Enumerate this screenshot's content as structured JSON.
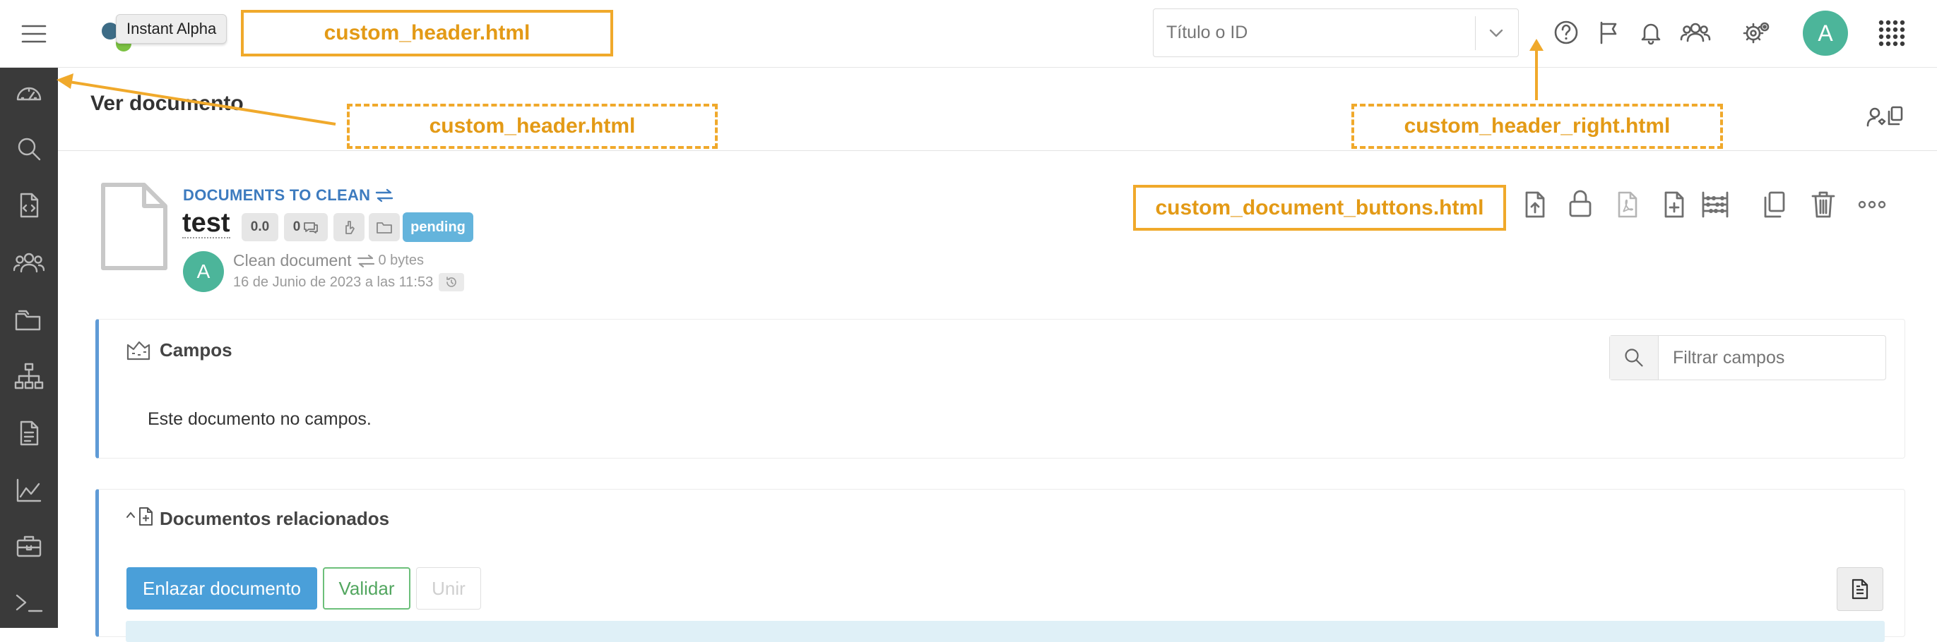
{
  "header": {
    "menu_icon": "hamburger-icon",
    "tooltip": "Instant Alpha",
    "search": {
      "placeholder": "Título o ID"
    },
    "avatar_letter": "A",
    "icons": [
      "help-icon",
      "flag-icon",
      "bell-icon",
      "users-icon",
      "gear-icon",
      "apps-grid-icon"
    ]
  },
  "annotations": {
    "header_top": "custom_header.html",
    "header_sidebar": "custom_header.html",
    "header_right": "custom_header_right.html",
    "document_buttons": "custom_document_buttons.html"
  },
  "sidebar": {
    "items": [
      "dashboard-icon",
      "search-icon",
      "code-file-icon",
      "users-icon",
      "folders-icon",
      "hierarchy-icon",
      "document-icon",
      "chart-icon",
      "toolbox-icon",
      "terminal-icon"
    ]
  },
  "page": {
    "title": "Ver documento"
  },
  "document": {
    "cabinet": "DOCUMENTS TO CLEAN",
    "name": "test",
    "version": "0.0",
    "comments": "0",
    "status": "pending",
    "type": "Clean document",
    "size": "0 bytes",
    "date": "16 de Junio de 2023 a las 11:53",
    "avatar_letter": "A"
  },
  "campos": {
    "title": "Campos",
    "filter_placeholder": "Filtrar campos",
    "empty_text": "Este documento no campos."
  },
  "related": {
    "title": "Documentos relacionados",
    "link_button": "Enlazar documento",
    "validate_button": "Validar",
    "merge_button": "Unir"
  },
  "colors": {
    "accent": "#4a9fd9",
    "status_badge": "#64b4dc",
    "avatar": "#4cb59a",
    "annotation": "#f0a92b",
    "sidebar": "#3a3a3a",
    "validate_border": "#6cbf7a",
    "cabinet_link": "#3d7bbf"
  }
}
